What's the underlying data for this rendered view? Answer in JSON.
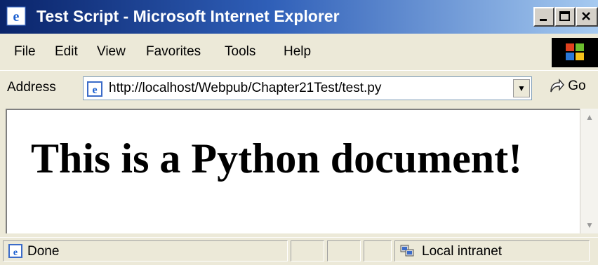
{
  "window": {
    "title": "Test Script - Microsoft Internet Explorer"
  },
  "menu": {
    "items": [
      "File",
      "Edit",
      "View",
      "Favorites",
      "Tools",
      "Help"
    ]
  },
  "address": {
    "label": "Address",
    "url": "http://localhost/Webpub/Chapter21Test/test.py",
    "go_label": "Go"
  },
  "page": {
    "heading": "This is a Python document!"
  },
  "status": {
    "text": "Done",
    "zone": "Local intranet"
  },
  "colors": {
    "title_bar_start": "#0a246a",
    "title_bar_end": "#a6caf0",
    "chrome": "#ece9d8"
  },
  "icons": [
    "ie-icon",
    "minimize-icon",
    "maximize-icon",
    "close-icon",
    "windows-logo-icon",
    "page-icon",
    "dropdown-arrow-icon",
    "go-arrow-icon",
    "scroll-up-icon",
    "scroll-down-icon",
    "intranet-icon"
  ]
}
